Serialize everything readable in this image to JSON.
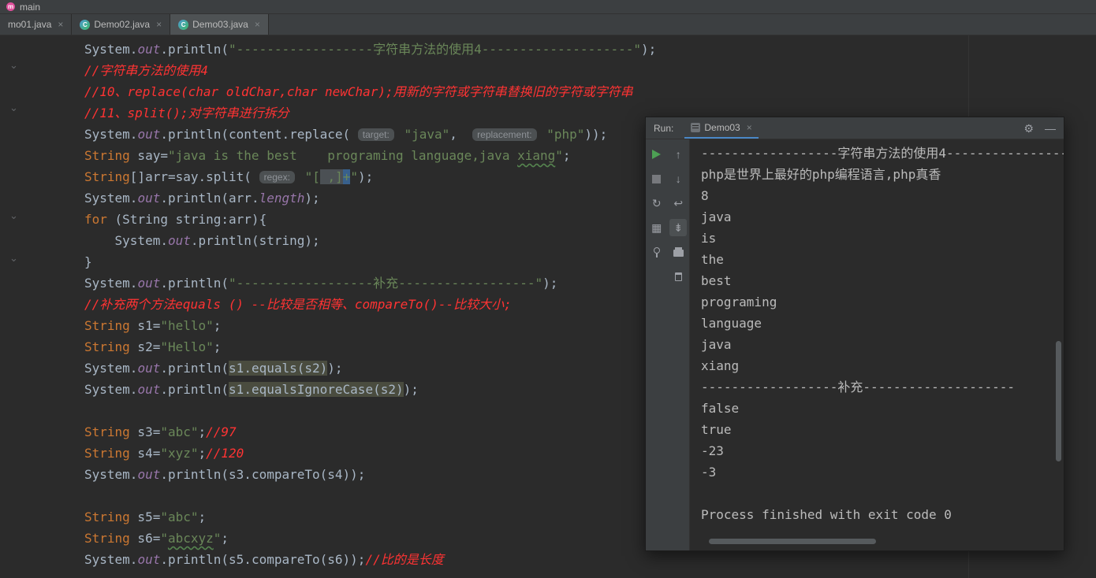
{
  "titlebar": {
    "branch": "main",
    "icon_letter": "m"
  },
  "tabs": [
    {
      "label": "mo01.java"
    },
    {
      "label": "Demo02.java"
    },
    {
      "label": "Demo03.java",
      "active": true
    }
  ],
  "icons": {
    "class_letter": "C",
    "close": "×",
    "gear": "⚙",
    "minimize": "—",
    "up": "↑",
    "down": "↓",
    "soft_wrap": "↩",
    "scroll_end": "⇟",
    "fold": "⌄",
    "rerun_failed": "↻",
    "restore_layout": "▦"
  },
  "editor": {
    "lines": [
      [
        {
          "t": "System.",
          "c": "p"
        },
        {
          "t": "out",
          "c": "f"
        },
        {
          "t": ".println(",
          "c": "p"
        },
        {
          "t": "\"------------------字符串方法的使用4--------------------\"",
          "c": "s"
        },
        {
          "t": ");",
          "c": "p"
        }
      ],
      [
        {
          "t": "//字符串方法的使用4",
          "c": "c"
        }
      ],
      [
        {
          "t": "//10、replace(char oldChar,char newChar);用新的字符或字符串替换旧的字符或字符串",
          "c": "c"
        }
      ],
      [
        {
          "t": "//11、split();对字符串进行拆分",
          "c": "c"
        }
      ],
      [
        {
          "t": "System.",
          "c": "p"
        },
        {
          "t": "out",
          "c": "f"
        },
        {
          "t": ".println(content.replace( ",
          "c": "p"
        },
        {
          "t": "target:",
          "c": "h"
        },
        {
          "t": " ",
          "c": "p"
        },
        {
          "t": "\"java\"",
          "c": "s"
        },
        {
          "t": ",  ",
          "c": "p"
        },
        {
          "t": "replacement:",
          "c": "h"
        },
        {
          "t": " ",
          "c": "p"
        },
        {
          "t": "\"php\"",
          "c": "s"
        },
        {
          "t": "));",
          "c": "p"
        }
      ],
      [
        {
          "t": "String",
          "c": "k"
        },
        {
          "t": " say=",
          "c": "p"
        },
        {
          "t": "\"java is the best    programing language,java ",
          "c": "s"
        },
        {
          "t": "xiang",
          "c": "s typo"
        },
        {
          "t": "\"",
          "c": "s"
        },
        {
          "t": ";",
          "c": "p"
        }
      ],
      [
        {
          "t": "String",
          "c": "k"
        },
        {
          "t": "[]arr=say.split( ",
          "c": "p"
        },
        {
          "t": "regex:",
          "c": "h"
        },
        {
          "t": " ",
          "c": "p"
        },
        {
          "t": "\"[",
          "c": "s"
        },
        {
          "t": " ,]",
          "c": "s sel1"
        },
        {
          "t": "+",
          "c": "s sel2"
        },
        {
          "t": "\"",
          "c": "s"
        },
        {
          "t": ");",
          "c": "p"
        }
      ],
      [
        {
          "t": "System.",
          "c": "p"
        },
        {
          "t": "out",
          "c": "f"
        },
        {
          "t": ".println(arr.",
          "c": "p"
        },
        {
          "t": "length",
          "c": "f"
        },
        {
          "t": ");",
          "c": "p"
        }
      ],
      [
        {
          "t": "for",
          "c": "k"
        },
        {
          "t": " (String string:arr){",
          "c": "p"
        }
      ],
      [
        {
          "t": "    System.",
          "c": "p"
        },
        {
          "t": "out",
          "c": "f"
        },
        {
          "t": ".println(string);",
          "c": "p"
        }
      ],
      [
        {
          "t": "}",
          "c": "p"
        }
      ],
      [
        {
          "t": "System.",
          "c": "p"
        },
        {
          "t": "out",
          "c": "f"
        },
        {
          "t": ".println(",
          "c": "p"
        },
        {
          "t": "\"------------------补充------------------\"",
          "c": "s"
        },
        {
          "t": ");",
          "c": "p"
        }
      ],
      [
        {
          "t": "//补充两个方法equals () --比较是否相等、compareTo()--比较大小;",
          "c": "c"
        }
      ],
      [
        {
          "t": "String",
          "c": "k"
        },
        {
          "t": " s1=",
          "c": "p"
        },
        {
          "t": "\"hello\"",
          "c": "s"
        },
        {
          "t": ";",
          "c": "p"
        }
      ],
      [
        {
          "t": "String",
          "c": "k"
        },
        {
          "t": " s2=",
          "c": "p"
        },
        {
          "t": "\"Hello\"",
          "c": "s"
        },
        {
          "t": ";",
          "c": "p"
        }
      ],
      [
        {
          "t": "System.",
          "c": "p"
        },
        {
          "t": "out",
          "c": "f"
        },
        {
          "t": ".println(",
          "c": "p"
        },
        {
          "t": "s1.equals(s2)",
          "c": "p hl"
        },
        {
          "t": ");",
          "c": "p"
        }
      ],
      [
        {
          "t": "System.",
          "c": "p"
        },
        {
          "t": "out",
          "c": "f"
        },
        {
          "t": ".println(",
          "c": "p"
        },
        {
          "t": "s1.equalsIgnoreCase(s2)",
          "c": "p hl"
        },
        {
          "t": ");",
          "c": "p"
        }
      ],
      [],
      [
        {
          "t": "String",
          "c": "k"
        },
        {
          "t": " s3=",
          "c": "p"
        },
        {
          "t": "\"abc\"",
          "c": "s"
        },
        {
          "t": ";",
          "c": "p"
        },
        {
          "t": "//97",
          "c": "c"
        }
      ],
      [
        {
          "t": "String",
          "c": "k"
        },
        {
          "t": " s4=",
          "c": "p"
        },
        {
          "t": "\"xyz\"",
          "c": "s"
        },
        {
          "t": ";",
          "c": "p"
        },
        {
          "t": "//120",
          "c": "c"
        }
      ],
      [
        {
          "t": "System.",
          "c": "p"
        },
        {
          "t": "out",
          "c": "f"
        },
        {
          "t": ".println(s3.compareTo(s4));",
          "c": "p"
        }
      ],
      [],
      [
        {
          "t": "String",
          "c": "k"
        },
        {
          "t": " s5=",
          "c": "p"
        },
        {
          "t": "\"abc\"",
          "c": "s"
        },
        {
          "t": ";",
          "c": "p"
        }
      ],
      [
        {
          "t": "String",
          "c": "k"
        },
        {
          "t": " s6=",
          "c": "p"
        },
        {
          "t": "\"",
          "c": "s"
        },
        {
          "t": "abcxyz",
          "c": "s typo"
        },
        {
          "t": "\"",
          "c": "s"
        },
        {
          "t": ";",
          "c": "p"
        }
      ],
      [
        {
          "t": "System.",
          "c": "p"
        },
        {
          "t": "out",
          "c": "f"
        },
        {
          "t": ".println(s5.compareTo(s6));",
          "c": "p"
        },
        {
          "t": "//比的是长度",
          "c": "c"
        }
      ]
    ]
  },
  "run_panel": {
    "title": "Run:",
    "tab": "Demo03",
    "console_lines": [
      "------------------字符串方法的使用4----------------",
      "php是世界上最好的php编程语言,php真香",
      "8",
      "java",
      "is",
      "the",
      "best",
      "programing",
      "language",
      "java",
      "xiang",
      "------------------补充--------------------",
      "false",
      "true",
      "-23",
      "-3",
      "",
      "Process finished with exit code 0"
    ]
  },
  "colors": {
    "background": "#2B2B2B",
    "panel": "#3C3F41",
    "keyword_orange": "#CC7832",
    "string_green": "#6A8759",
    "comment_red": "#FF3333",
    "field_purple": "#9876AA",
    "run_green": "#4DA054",
    "accent_blue": "#4A88C7"
  }
}
